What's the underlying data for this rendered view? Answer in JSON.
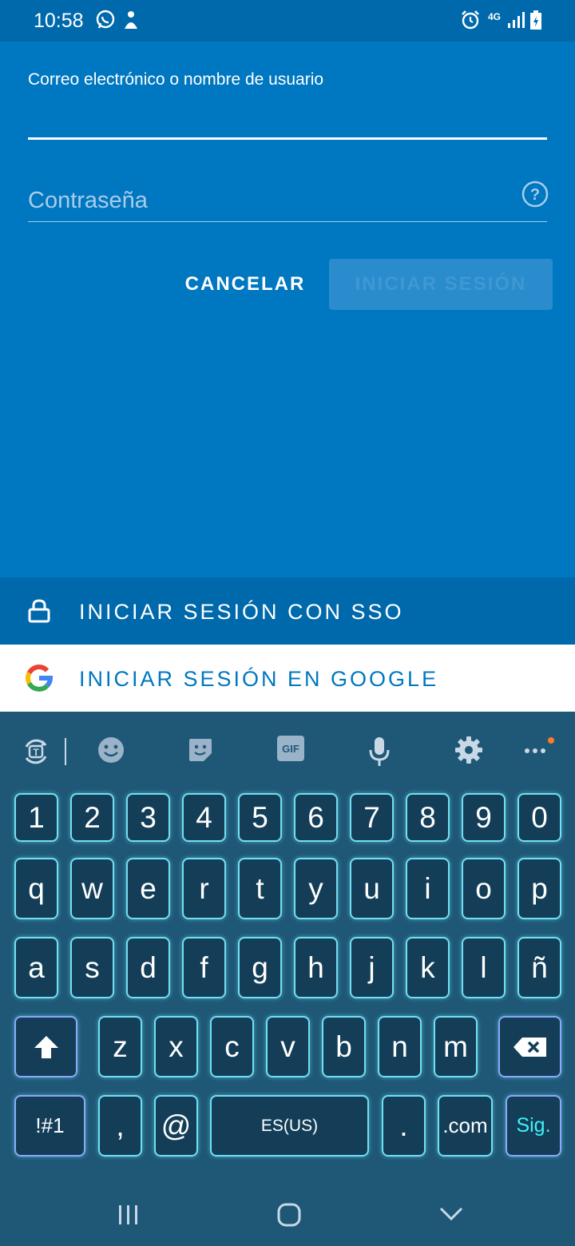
{
  "status_bar": {
    "time": "10:58",
    "network": "4G"
  },
  "colors": {
    "primary": "#0077c1",
    "primary_dark": "#0069ab",
    "keyboard_bg": "#1f5876",
    "key_glow": "#6fe0f4"
  },
  "form": {
    "email_label": "Correo electrónico o nombre de usuario",
    "email_value": "",
    "password_placeholder": "Contraseña",
    "cancel_label": "CANCELAR",
    "login_label": "INICIAR SESIÓN"
  },
  "sso": {
    "label": "INICIAR SESIÓN CON SSO",
    "icon": "lock-icon"
  },
  "google": {
    "label": "INICIAR SESIÓN EN GOOGLE",
    "icon": "google-icon"
  },
  "keyboard": {
    "toolbar": [
      "translate-icon",
      "emoji-icon",
      "sticker-icon",
      "gif-icon",
      "mic-icon",
      "settings-icon",
      "more-icon"
    ],
    "gif_label": "GIF",
    "rows": [
      [
        "1",
        "2",
        "3",
        "4",
        "5",
        "6",
        "7",
        "8",
        "9",
        "0"
      ],
      [
        "q",
        "w",
        "e",
        "r",
        "t",
        "y",
        "u",
        "i",
        "o",
        "p"
      ],
      [
        "a",
        "s",
        "d",
        "f",
        "g",
        "h",
        "j",
        "k",
        "l",
        "ñ"
      ],
      [
        "z",
        "x",
        "c",
        "v",
        "b",
        "n",
        "m"
      ]
    ],
    "symbols_key": "!#1",
    "comma_key": ",",
    "at_key": "@",
    "space_key": "ES(US)",
    "period_key": ".",
    "dotcom_key": ".com",
    "next_key": "Sig."
  }
}
